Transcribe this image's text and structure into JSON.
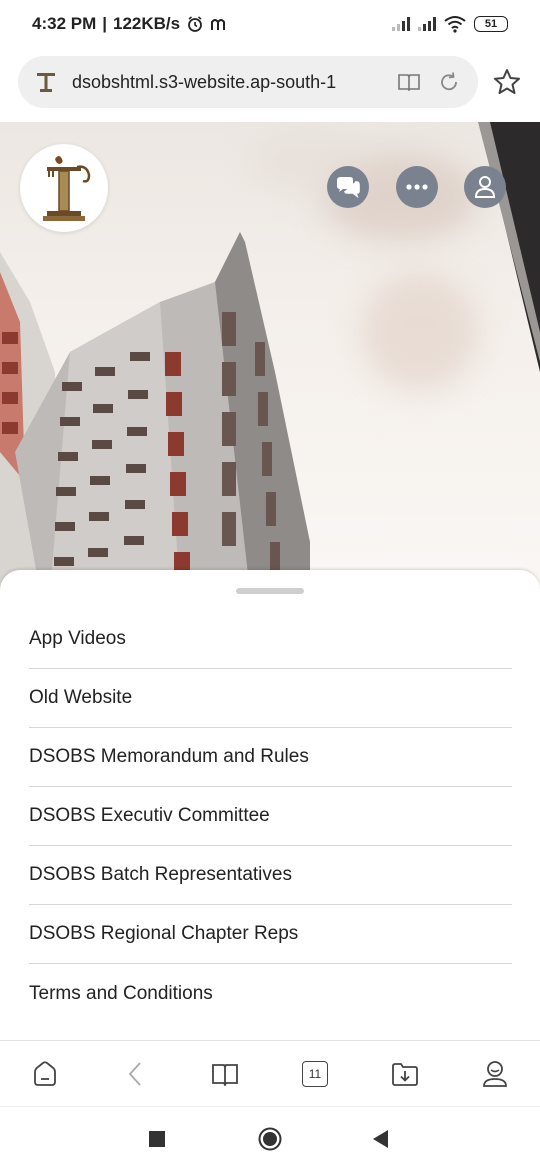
{
  "status_bar": {
    "time": "4:32 PM",
    "speed": "122KB/s",
    "battery": "51"
  },
  "browser": {
    "url": "dsobshtml.s3-website.ap-south-1",
    "tab_count": "11"
  },
  "menu": {
    "items": [
      "App Videos",
      "Old Website",
      "DSOBS Memorandum and Rules",
      "DSOBS Executiv Committee",
      "DSOBS Batch Representatives",
      "DSOBS Regional Chapter Reps",
      "Terms and Conditions"
    ]
  },
  "colors": {
    "header_button": "#7a818f",
    "logo_brown": "#8a6a3a"
  },
  "icons": {
    "status": [
      "alarm-icon",
      "m-icon",
      "signal-icon",
      "wifi-icon",
      "battery-icon"
    ],
    "header": [
      "chat-icon",
      "more-icon",
      "user-icon"
    ],
    "toolbar": [
      "home-icon",
      "back-icon",
      "reader-icon",
      "tabs-icon",
      "downloads-icon",
      "profile-icon"
    ],
    "system": [
      "recents-icon",
      "home-circle-icon",
      "back-triangle-icon"
    ]
  }
}
